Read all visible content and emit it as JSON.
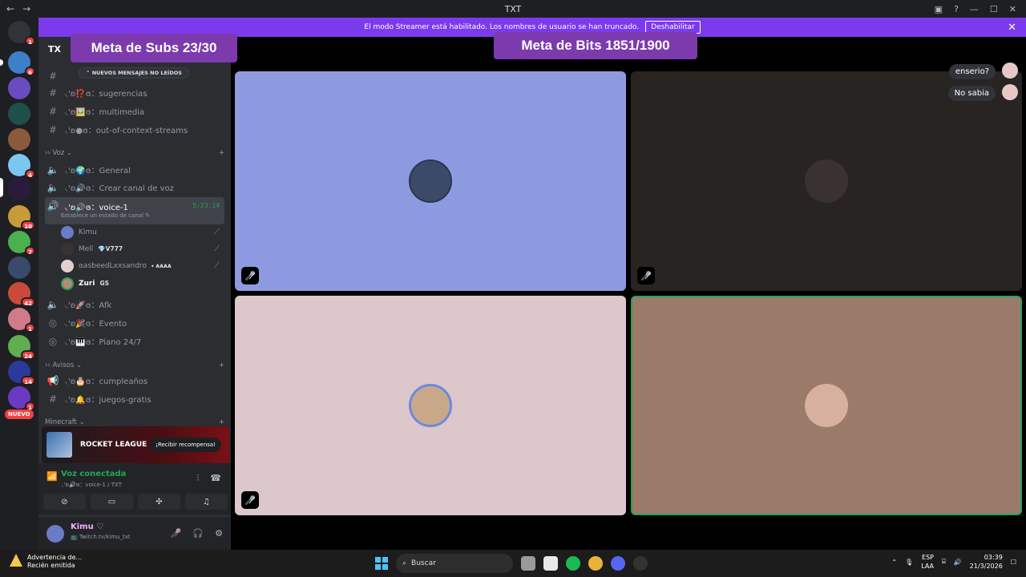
{
  "window": {
    "title": "TXT",
    "back": "←",
    "forward": "→"
  },
  "streamer_bar": {
    "message": "El modo Streamer está habilitado. Los nombres de usuario se han truncado.",
    "button": "Deshabilitar",
    "close": "✕"
  },
  "overlays": {
    "subs": "Meta de Subs  23/30",
    "bits": "Meta de Bits  1851/1900"
  },
  "guild_badges": [
    "1",
    "6",
    "4",
    "10",
    "7",
    "42",
    "1",
    "24",
    "14",
    "1"
  ],
  "nuevo_label": "NUEVO",
  "server": {
    "name": "TX"
  },
  "unread_pill": "NUEVOS MENSAJES NO LEÍDOS",
  "text_channels_top": [
    {
      "name": "⸜'ʚ⁉️ɞ：sugerencias"
    },
    {
      "name": "⸜'ʚ🖼️ɞ：multimedia"
    },
    {
      "name": "⸜'ʚ●ɞ：out-of-context-streams"
    }
  ],
  "categories": {
    "voz": "Voz",
    "avisos": "Avisos",
    "minecraft": "Minecraft"
  },
  "voice_channels": [
    {
      "name": "⸜'ʚ🌍ɞ：General"
    },
    {
      "name": "⸜'ʚ🔊ɞ：Crear canal de voz"
    }
  ],
  "active_channel": {
    "name": "⸜'ʚ🔊ɞ：voice-1",
    "timer": "5:23:14",
    "status": "Establece un estado de canal ✎"
  },
  "members": [
    {
      "name": "Kimu",
      "tag": ""
    },
    {
      "name": "Mell",
      "tag": "💎V777"
    },
    {
      "name": "αasbeedLxxsandro",
      "tag": "⬩ ᴀᴀᴀᴀ"
    },
    {
      "name": "Zuri",
      "tag": "GS"
    }
  ],
  "other_voice": [
    {
      "name": "⸜'ʚ🚀ɞ：Afk"
    },
    {
      "name": "⸜'ʚ🎉ɞ：Evento"
    },
    {
      "name": "⸜'ʚ🎹ɞ：Piano 24/7"
    }
  ],
  "avisos_channels": [
    {
      "name": "⸜'ʚ🎂ɞ：cumpleaños"
    },
    {
      "name": "⸜'ʚ🔔ɞ：juegos-gratis"
    }
  ],
  "promo": {
    "logo": "ROCKET LEAGUE",
    "cta": "¡Recibir recompensa!"
  },
  "voice_panel": {
    "status": "Voz conectada",
    "sub": "⸜'ʚ🔊ɞ：voice-1 / TXT"
  },
  "user": {
    "name": "Kimu ♡",
    "sub": "📺 Twitch.tv/kimu_txt"
  },
  "chat": [
    {
      "text": "enserio?"
    },
    {
      "text": "No sabia"
    }
  ],
  "taskbar": {
    "warning_title": "Advertencia de...",
    "warning_sub": "Recién emitida",
    "search": "Buscar",
    "lang": "ESP",
    "lang2": "LAA",
    "time": "03:39",
    "date": "21/3/2026"
  },
  "colors": {
    "accent": "#7c3aed",
    "tile1": "#8e9ae0",
    "tile2": "#272422",
    "tile3": "#dcc7ca",
    "tile4": "#9c7a6a",
    "speaking": "#23a559"
  }
}
